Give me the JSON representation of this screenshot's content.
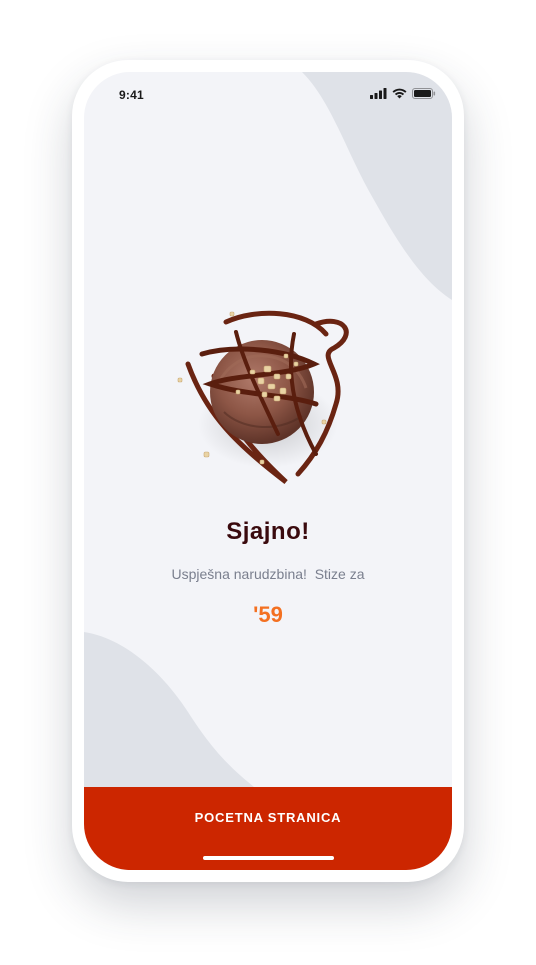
{
  "status_bar": {
    "time": "9:41",
    "icons": [
      "signal-icon",
      "wifi-icon",
      "battery-icon"
    ]
  },
  "hero": {
    "image": "ice-cream-scoop-with-chocolate-syrup-and-nuts"
  },
  "message": {
    "title": "Sjajno!",
    "subtitle": "Uspješna narudzbina!  Stize za",
    "eta": "'59"
  },
  "cta": {
    "label": "POCETNA STRANICA"
  },
  "colors": {
    "background": "#f3f4f8",
    "blob": "#dfe2e8",
    "title": "#3a0a0e",
    "subtitle": "#7a7f8e",
    "accent": "#f37021",
    "button": "#cc2600"
  }
}
